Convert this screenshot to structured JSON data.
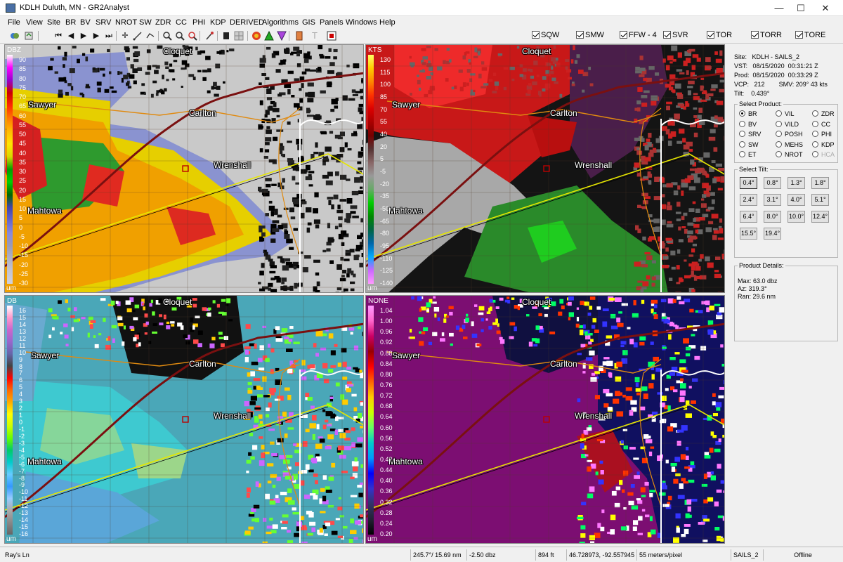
{
  "window": {
    "title": "KDLH Duluth, MN - GR2Analyst",
    "minimize": "—",
    "maximize": "☐",
    "close": "✕"
  },
  "menu": [
    "File",
    "View",
    "Site",
    "BR",
    "BV",
    "SRV",
    "NROT",
    "SW",
    "ZDR",
    "CC",
    "PHI",
    "KDP",
    "DERIVED",
    "Algorithms",
    "GIS",
    "Panels",
    "Windows",
    "Help"
  ],
  "warnings": [
    "SQW",
    "SMW",
    "FFW - 4",
    "SVR",
    "TOR",
    "TORR",
    "TORE"
  ],
  "panels": {
    "tl": {
      "unit": "DBZ",
      "ticks": [
        "90",
        "85",
        "80",
        "75",
        "70",
        "65",
        "60",
        "55",
        "50",
        "45",
        "40",
        "35",
        "30",
        "25",
        "20",
        "15",
        "10",
        "5",
        "0",
        "-5",
        "-10",
        "-15",
        "-20",
        "-25",
        "-30"
      ],
      "um": "um",
      "colors": [
        "#ffffff",
        "#ff00ff",
        "#9900cc",
        "#cc0000",
        "#ff2a00",
        "#ff7a00",
        "#ffbb00",
        "#ffe600",
        "#d8d800",
        "#00a000",
        "#00d000",
        "#006600",
        "#4444aa",
        "#6666cc",
        "#8888dd",
        "#9a9ab5",
        "#b0b0c4",
        "#c4c4d2",
        "#d0d0da"
      ]
    },
    "tr": {
      "unit": "KTS",
      "ticks": [
        "130",
        "115",
        "100",
        "85",
        "70",
        "55",
        "40",
        "20",
        "5",
        "-5",
        "-20",
        "-35",
        "-50",
        "-65",
        "-80",
        "-95",
        "-110",
        "-125",
        "-140"
      ],
      "um": "um",
      "colors": [
        "#ffff66",
        "#ffcc00",
        "#ff8800",
        "#ff3300",
        "#dd0000",
        "#aa0000",
        "#770000",
        "#553333",
        "#886666",
        "#999999",
        "#66aa66",
        "#00cc00",
        "#008800",
        "#006644",
        "#0066aa",
        "#00aaff",
        "#cc66ff",
        "#ff99ff"
      ]
    },
    "bl": {
      "unit": "DB",
      "ticks": [
        "16",
        "15",
        "14",
        "13",
        "12",
        "11",
        "10",
        "9",
        "8",
        "7",
        "6",
        "5",
        "4",
        "3",
        "2",
        "1",
        "0",
        "-1",
        "-2",
        "-3",
        "-4",
        "-5",
        "-6",
        "-7",
        "-8",
        "-9",
        "-10",
        "-11",
        "-12",
        "-13",
        "-14",
        "-15",
        "-16"
      ],
      "um": "um",
      "colors": [
        "#ffffff",
        "#ff99cc",
        "#cc66cc",
        "#9966cc",
        "#6666aa",
        "#444444",
        "#ff0000",
        "#ff6600",
        "#ffaa00",
        "#ffff00",
        "#ccff00",
        "#66ff00",
        "#00cc66",
        "#00cccc",
        "#66ccff",
        "#3399ff",
        "#99ccff",
        "#aaaaaa",
        "#888888",
        "#666666"
      ]
    },
    "br": {
      "unit": "NONE",
      "ticks": [
        "1.04",
        "1.00",
        "0.96",
        "0.92",
        "0.88",
        "0.84",
        "0.80",
        "0.76",
        "0.72",
        "0.68",
        "0.64",
        "0.60",
        "0.56",
        "0.52",
        "0.48",
        "0.44",
        "0.40",
        "0.36",
        "0.32",
        "0.28",
        "0.24",
        "0.20"
      ],
      "um": "um",
      "colors": [
        "#ff99ff",
        "#ff66cc",
        "#cc0066",
        "#990000",
        "#ff0000",
        "#ff6600",
        "#ffcc00",
        "#ccff00",
        "#66ff66",
        "#00cccc",
        "#0099ff",
        "#0000ff",
        "#3333cc",
        "#333366",
        "#222233",
        "#000000"
      ]
    }
  },
  "cities": {
    "cloquet": "Cloquet",
    "sawyer": "Sawyer",
    "carlton": "Carlton",
    "wrenshall": "Wrenshall",
    "mahtowa": "Mahtowa"
  },
  "info": {
    "site_label": "Site:",
    "site": "KDLH - SAILS_2",
    "vst_label": "VST:",
    "vst_date": "08/15/2020",
    "vst_time": "00:31:21 Z",
    "prod_label": "Prod:",
    "prod_date": "08/15/2020",
    "prod_time": "00:33:29 Z",
    "vcp_label": "VCP:",
    "vcp": "212",
    "smv_label": "SMV:",
    "smv": "209° 43 kts",
    "tilt_label": "Tilt:",
    "tilt": "0.439°"
  },
  "select_product": {
    "title": "Select Product:",
    "items": [
      {
        "label": "BR",
        "on": true
      },
      {
        "label": "VIL"
      },
      {
        "label": "ZDR"
      },
      {
        "label": "BV"
      },
      {
        "label": "VILD"
      },
      {
        "label": "CC"
      },
      {
        "label": "SRV"
      },
      {
        "label": "POSH"
      },
      {
        "label": "PHI"
      },
      {
        "label": "SW"
      },
      {
        "label": "MEHS"
      },
      {
        "label": "KDP"
      },
      {
        "label": "ET"
      },
      {
        "label": "NROT"
      },
      {
        "label": "HCA",
        "disabled": true
      }
    ]
  },
  "select_tilt": {
    "title": "Select Tilt:",
    "items": [
      "0.4°",
      "0.8°",
      "1.3°",
      "1.8°",
      "2.4°",
      "3.1°",
      "4.0°",
      "5.1°",
      "6.4°",
      "8.0°",
      "10.0°",
      "12.4°",
      "15.5°",
      "19.4°"
    ],
    "selected": "0.4°"
  },
  "product_details": {
    "title": "Product Details:",
    "max": "Max:  63.0 dbz",
    "az": "Az:  319.3°",
    "ran": "Ran:  29.6 nm"
  },
  "status": {
    "road": "Ray's Ln",
    "azran": "245.7°/ 15.69 nm",
    "value": "-2.50 dbz",
    "height": "894 ft",
    "coords": "46.728973, -92.557945",
    "scale": "55 meters/pixel",
    "site": "SAILS_2",
    "state": "Offline"
  }
}
